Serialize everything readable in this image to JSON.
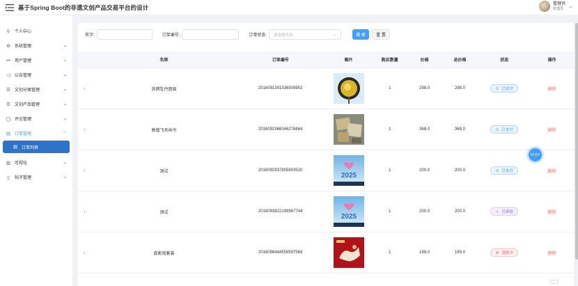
{
  "app": {
    "title": "基于Spring Boot的非遗文创产品交易平台的设计"
  },
  "user": {
    "name": "管理员",
    "role": "管理员"
  },
  "sidebar": {
    "items": [
      {
        "label": "个人中心",
        "icon": "user-icon"
      },
      {
        "label": "系统管理",
        "icon": "gear-icon"
      },
      {
        "label": "用户管理",
        "icon": "users-icon"
      },
      {
        "label": "公告管理",
        "icon": "speaker-icon"
      },
      {
        "label": "文创分类管理",
        "icon": "list-icon"
      },
      {
        "label": "文创产品管理",
        "icon": "list-icon"
      },
      {
        "label": "评论管理",
        "icon": "comment-icon"
      },
      {
        "label": "订单管理",
        "icon": "document-icon"
      },
      {
        "label": "订单列表",
        "icon": "document-icon"
      },
      {
        "label": "可视化",
        "icon": "chart-icon"
      },
      {
        "label": "帖子管理",
        "icon": "file-icon"
      }
    ]
  },
  "search": {
    "name_label": "名字:",
    "order_no_label": "订单编号:",
    "status_label": "订单状态:",
    "status_placeholder": "请选择状态",
    "search_button": "搜 索",
    "reset_button": "重 置"
  },
  "table": {
    "headers": [
      "名称",
      "订单编号",
      "图片",
      "购买数量",
      "价格",
      "总价格",
      "状态",
      "操作"
    ],
    "rows": [
      {
        "name": "苏绣牡丹团扇",
        "order_no": "2016091301536509952",
        "qty": "1",
        "price": "298.0",
        "total": "298.0",
        "status": "已支付",
        "op": "删除"
      },
      {
        "name": "敦煌飞天丝巾",
        "order_no": "2016091966346276864",
        "qty": "1",
        "price": "368.0",
        "total": "368.0",
        "status": "已支付",
        "op": "删除"
      },
      {
        "name": "测试",
        "order_no": "2016092937805803520",
        "qty": "1",
        "price": "200.0",
        "total": "200.0",
        "status": "已支付",
        "op": "删除"
      },
      {
        "name": "测试",
        "order_no": "2016093822199967744",
        "qty": "1",
        "price": "200.0",
        "total": "200.0",
        "status": "已评价",
        "op": "删除"
      },
      {
        "name": "皮影戏套装",
        "order_no": "2016096484559597568",
        "qty": "1",
        "price": "199.0",
        "total": "199.0",
        "status": "退款中",
        "op": "删除"
      }
    ],
    "image_captions": [
      "2025",
      "2025"
    ]
  },
  "timer": "01:07",
  "colors": {
    "accent": "#409eff",
    "sidebar_active": "#2f73c9",
    "danger": "#f56c6c"
  }
}
